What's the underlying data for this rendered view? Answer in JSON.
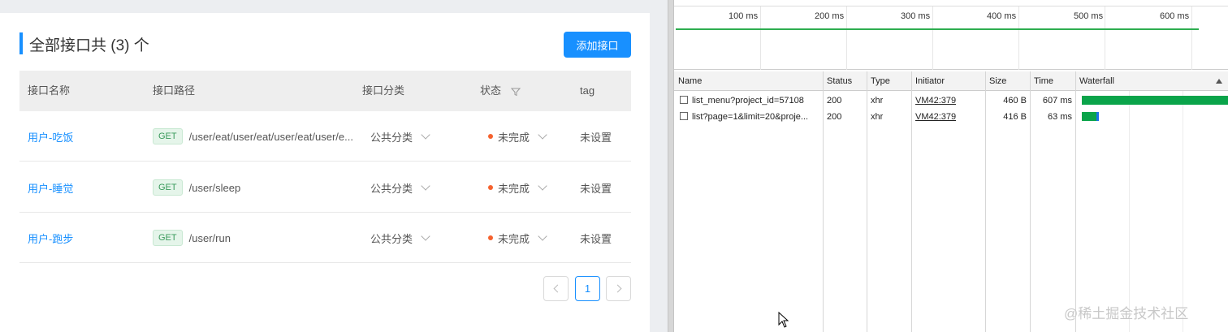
{
  "app": {
    "title": "全部接口共 (3) 个",
    "add_button": "添加接口",
    "columns": [
      "接口名称",
      "接口路径",
      "接口分类",
      "状态",
      "tag"
    ],
    "rows": [
      {
        "name": "用户-吃饭",
        "method": "GET",
        "path": "/user/eat/user/eat/user/eat/user/e...",
        "category": "公共分类",
        "status": "未完成",
        "tag": "未设置"
      },
      {
        "name": "用户-睡觉",
        "method": "GET",
        "path": "/user/sleep",
        "category": "公共分类",
        "status": "未完成",
        "tag": "未设置"
      },
      {
        "name": "用户-跑步",
        "method": "GET",
        "path": "/user/run",
        "category": "公共分类",
        "status": "未完成",
        "tag": "未设置"
      }
    ],
    "pagination": {
      "current": "1"
    },
    "colors": {
      "primary": "#1890ff",
      "status_dot": "#f5622e",
      "get_badge_bg": "#e5f5ea"
    }
  },
  "devtools": {
    "timeline_ticks": [
      "100 ms",
      "200 ms",
      "300 ms",
      "400 ms",
      "500 ms",
      "600 ms"
    ],
    "columns": [
      "Name",
      "Status",
      "Type",
      "Initiator",
      "Size",
      "Time",
      "Waterfall"
    ],
    "requests": [
      {
        "name": "list_menu?project_id=57108",
        "status": "200",
        "type": "xhr",
        "initiator": "VM42:379",
        "size": "460 B",
        "time": "607 ms"
      },
      {
        "name": "list?page=1&limit=20&proje...",
        "status": "200",
        "type": "xhr",
        "initiator": "VM42:379",
        "size": "416 B",
        "time": "63 ms"
      }
    ],
    "colors": {
      "waterfall": "#0aa44a",
      "overview_line": "#2ead50"
    }
  },
  "watermark": "@稀土掘金技术社区"
}
